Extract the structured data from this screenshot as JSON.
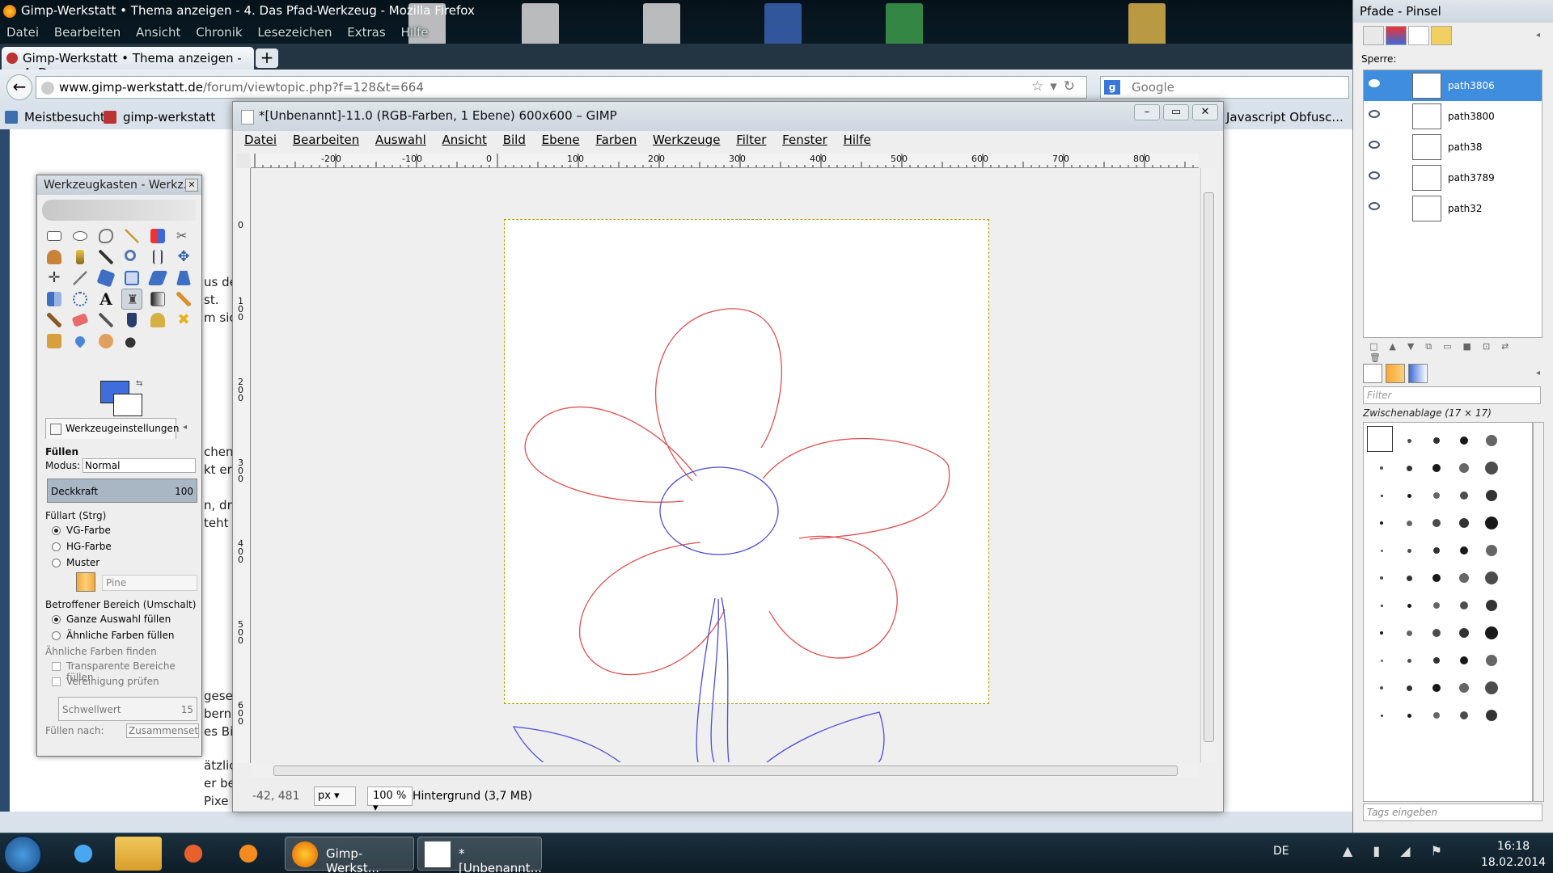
{
  "firefox": {
    "window_title": "Gimp-Werkstatt • Thema anzeigen - 4. Das Pfad-Werkzeug - Mozilla Firefox",
    "menu": [
      "Datei",
      "Bearbeiten",
      "Ansicht",
      "Chronik",
      "Lesezeichen",
      "Extras",
      "Hilfe"
    ],
    "tab_label": "Gimp-Werkstatt • Thema anzeigen - 4. D...",
    "new_tab": "+",
    "url_domain": "www.gimp-werkstatt.de",
    "url_path": "/forum/viewtopic.php?f=128&t=664",
    "search_placeholder": "Google",
    "bookmarks": [
      "Meistbesucht",
      "gimp-werkstatt",
      "Javascript Obfusc..."
    ],
    "page_fragments": [
      "us de",
      "st.",
      "m sic",
      "chen",
      "kt er",
      "n, dr",
      "teht",
      "gese",
      "bern",
      "es Bi",
      "ätzlic",
      "er be",
      "Pixe"
    ]
  },
  "toolbox": {
    "title": "Werkzeugkasten - Werkz...",
    "options_tab": "Werkzeugeinstellungen",
    "tool_name": "Füllen",
    "mode_label": "Modus:",
    "mode_value": "Normal",
    "opacity_label": "Deckkraft",
    "opacity_value": "100",
    "fill_type_label": "Füllart  (Strg)",
    "fill_fg": "VG-Farbe",
    "fill_bg": "HG-Farbe",
    "fill_pattern": "Muster",
    "pattern_name": "Pine",
    "area_label": "Betroffener Bereich (Umschalt)",
    "area_whole": "Ganze Auswahl füllen",
    "area_similar": "Ähnliche Farben füllen",
    "find_similar": "Ähnliche Farben finden",
    "transparent": "Transparente Bereiche füllen",
    "merged": "Vereinigung prüfen",
    "threshold_label": "Schwellwert",
    "threshold_value": "15",
    "fill_by_label": "Füllen nach:",
    "fill_by_value": "Zusammensetzung",
    "fg_color": "#3f6ddb",
    "bg_color": "#ffffff"
  },
  "image_window": {
    "title": "*[Unbenannt]-11.0 (RGB-Farben, 1 Ebene) 600x600 – GIMP",
    "menu": [
      "Datei",
      "Bearbeiten",
      "Auswahl",
      "Ansicht",
      "Bild",
      "Ebene",
      "Farben",
      "Werkzeuge",
      "Filter",
      "Fenster",
      "Hilfe"
    ],
    "ruler_top": [
      "-200",
      "-100",
      "0",
      "100",
      "200",
      "300",
      "400",
      "500",
      "600",
      "700",
      "800"
    ],
    "ruler_left": [
      "0",
      "100",
      "200",
      "300",
      "400",
      "500",
      "600"
    ],
    "coords": "-42, 481",
    "unit": "px",
    "zoom": "100 %",
    "layer_info": "Hintergrund (3,7 MB)",
    "petal_color": "#e05050",
    "stem_color": "#4d4ddb"
  },
  "dock": {
    "title": "Pfade - Pinsel",
    "lock_label": "Sperre:",
    "paths": [
      {
        "name": "path3806",
        "selected": true
      },
      {
        "name": "path3800",
        "selected": false
      },
      {
        "name": "path38",
        "selected": false
      },
      {
        "name": "path3789",
        "selected": false
      },
      {
        "name": "path32",
        "selected": false
      }
    ],
    "filter_placeholder": "Filter",
    "brush_name": "Zwischenablage (17 × 17)",
    "tags_placeholder": "Tags eingeben"
  },
  "taskbar": {
    "buttons": [
      "Gimp-Werkst...",
      "*[Unbenannt..."
    ],
    "lang": "DE",
    "time": "16:18",
    "date": "18.02.2014"
  }
}
